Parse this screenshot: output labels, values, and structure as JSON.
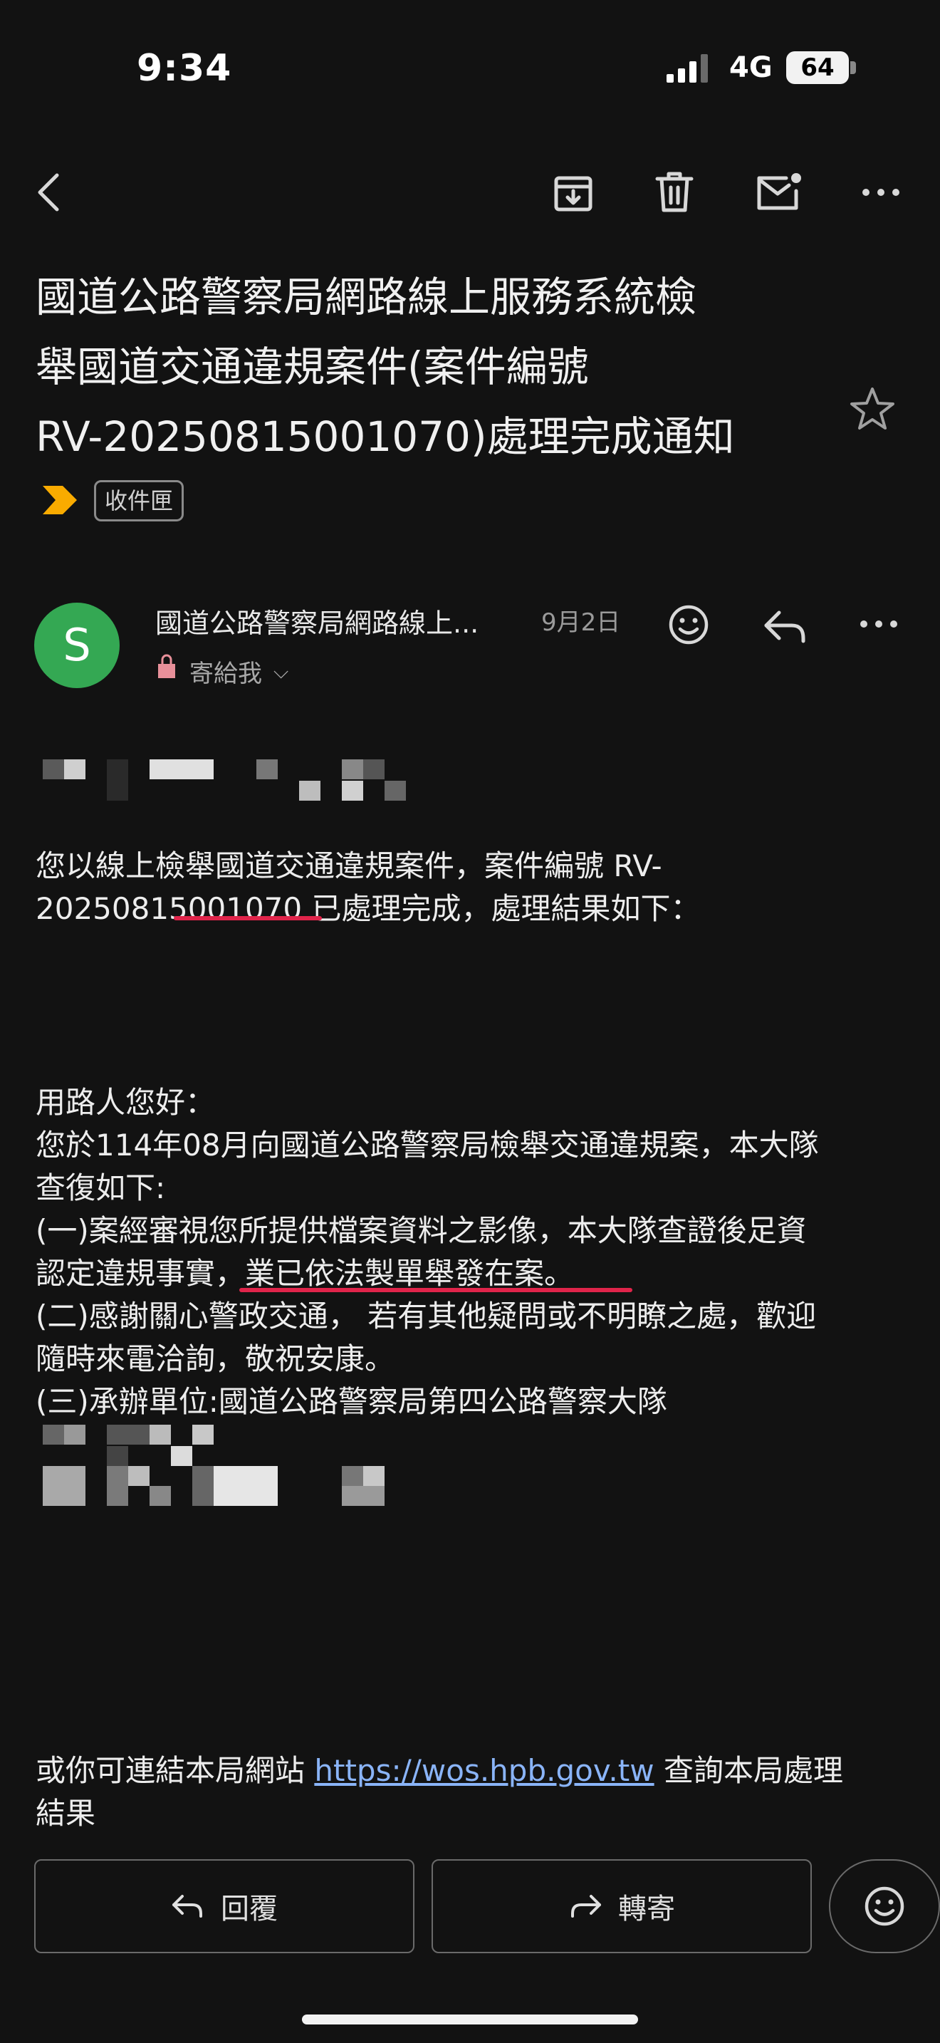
{
  "status_bar": {
    "time": "9:34",
    "network": "4G",
    "battery": "64"
  },
  "toolbar": {
    "back": "back-icon",
    "archive": "archive-icon",
    "delete": "trash-icon",
    "mark_unread": "mail-unread-icon",
    "more": "more-icon"
  },
  "email": {
    "subject_lines": [
      "國道公路警察局網路線上服務系統檢",
      "舉國道交通違規案件(案件編號",
      "RV-20250815001070)處理完成通知"
    ],
    "label": "收件匣",
    "sender": {
      "avatar_letter": "S",
      "name": "國道公路警察局網路線上...",
      "date": "9月2日",
      "to": "寄給我",
      "avatar_color": "#34a853"
    },
    "body": {
      "intro_line1": "您以線上檢舉國道交通違規案件，案件編號 RV-",
      "intro_line2": "20250815001070 已處理完成，處理結果如下：",
      "greeting": "用路人您好：",
      "p1": "您於114年08月向國道公路警察局檢舉交通違規案，本大隊",
      "p2": "查復如下:",
      "p3": "(一)案經審視您所提供檔案資料之影像，本大隊查證後足資",
      "p4": "認定違規事實，業已依法製單舉發在案。",
      "p5": "(二)感謝關心警政交通， 若有其他疑問或不明瞭之處，歡迎",
      "p6": "隨時來電洽詢，敬祝安康。",
      "p7": "(三)承辦單位:國道公路警察局第四公路警察大隊",
      "footer_pre": "或你可連結本局網站 ",
      "footer_link": "https://wos.hpb.gov.tw",
      "footer_post": " 查詢本局處理",
      "footer_line2": "結果"
    }
  },
  "actions": {
    "reply": "回覆",
    "forward": "轉寄"
  },
  "colors": {
    "accent_link": "#8ab4f8",
    "underline": "#e0244a",
    "label_arrow": "#f9ab00"
  }
}
